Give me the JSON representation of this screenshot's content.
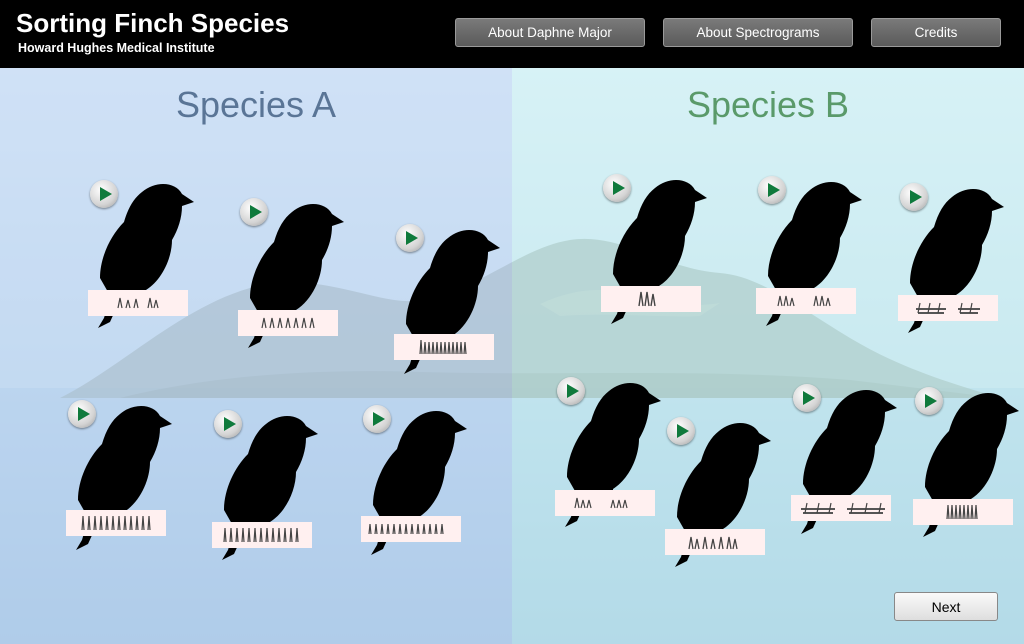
{
  "header": {
    "title": "Sorting Finch Species",
    "subtitle": "Howard Hughes Medical Institute",
    "buttons": [
      "About Daphne Major",
      "About Spectrograms",
      "Credits"
    ]
  },
  "panels": {
    "species_a": "Species A",
    "species_b": "Species B"
  },
  "footer": {
    "next_label": "Next"
  },
  "colors": {
    "header_bg": "#000000",
    "heading_a": "#5a7596",
    "heading_b": "#5a9a6a",
    "play_icon": "#0f7a3c"
  },
  "icons": [
    "play-icon",
    "finch-silhouette-icon",
    "spectrogram-card"
  ]
}
